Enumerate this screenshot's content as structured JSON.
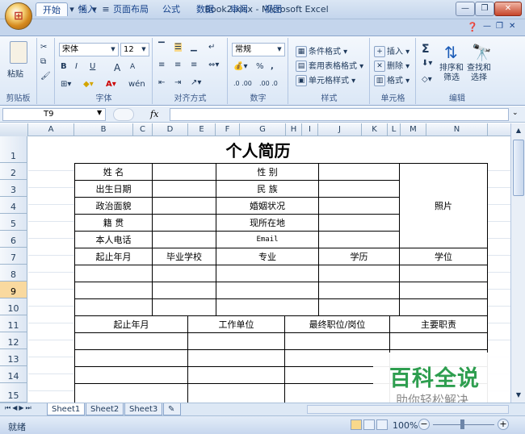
{
  "window": {
    "title": "Book2.xlsx - Microsoft Excel",
    "qat_icons": [
      "save-icon",
      "undo-icon",
      "redo-icon",
      "customize-icon"
    ],
    "controls": [
      "minimize",
      "restore",
      "close"
    ]
  },
  "ribbon": {
    "tabs": [
      {
        "label": "开始",
        "active": true
      },
      {
        "label": "插入"
      },
      {
        "label": "页面布局"
      },
      {
        "label": "公式"
      },
      {
        "label": "数据"
      },
      {
        "label": "审阅"
      },
      {
        "label": "视图"
      }
    ],
    "groups": {
      "clipboard": {
        "label": "剪贴板",
        "paste": "粘贴"
      },
      "font": {
        "label": "字体",
        "font_name": "宋体",
        "font_size": "12",
        "bold": "B",
        "italic": "I",
        "underline": "U",
        "grow": "A",
        "shrink": "A",
        "phonetic": "wén"
      },
      "alignment": {
        "label": "对齐方式"
      },
      "number": {
        "label": "数字",
        "format": "常规",
        "percent": "%",
        "comma": ",",
        "inc_decimal": ".0 .00",
        "dec_decimal": ".00 .0"
      },
      "styles": {
        "label": "样式",
        "conditional": "条件格式",
        "table": "套用表格格式",
        "cell_styles": "单元格样式"
      },
      "cells": {
        "label": "单元格",
        "insert": "插入",
        "delete": "删除",
        "format": "格式"
      },
      "editing": {
        "label": "编辑",
        "sigma": "Σ",
        "sort_filter": "排序和\n筛选",
        "find_select": "查找和\n选择"
      }
    }
  },
  "formula_bar": {
    "name_box": "T9",
    "fx": "fx",
    "value": ""
  },
  "columns": [
    "A",
    "B",
    "C",
    "D",
    "E",
    "F",
    "G",
    "H",
    "I",
    "J",
    "K",
    "L",
    "M",
    "N"
  ],
  "rows": [
    "1",
    "2",
    "3",
    "4",
    "5",
    "6",
    "7",
    "8",
    "9",
    "10",
    "11",
    "12",
    "13",
    "14",
    "15"
  ],
  "selected_row": "9",
  "sheet": {
    "title": "个人简历",
    "r2": [
      "姓    名",
      "性    别"
    ],
    "r3": [
      "出生日期",
      "民    族"
    ],
    "r4": [
      "政治面貌",
      "婚姻状况"
    ],
    "r5": [
      "籍    贯",
      "现所在地"
    ],
    "r6": [
      "本人电话",
      "Email"
    ],
    "photo": "照片",
    "r7": [
      "起止年月",
      "毕业学校",
      "专业",
      "学历",
      "学位"
    ],
    "r11": [
      "起止年月",
      "工作单位",
      "最终职位/岗位",
      "主要职责"
    ]
  },
  "sheet_tabs": [
    "Sheet1",
    "Sheet2",
    "Sheet3"
  ],
  "status": {
    "ready": "就绪",
    "zoom": "100%"
  },
  "watermark": {
    "title": "百科全说",
    "subtitle": "助你轻松解决"
  }
}
